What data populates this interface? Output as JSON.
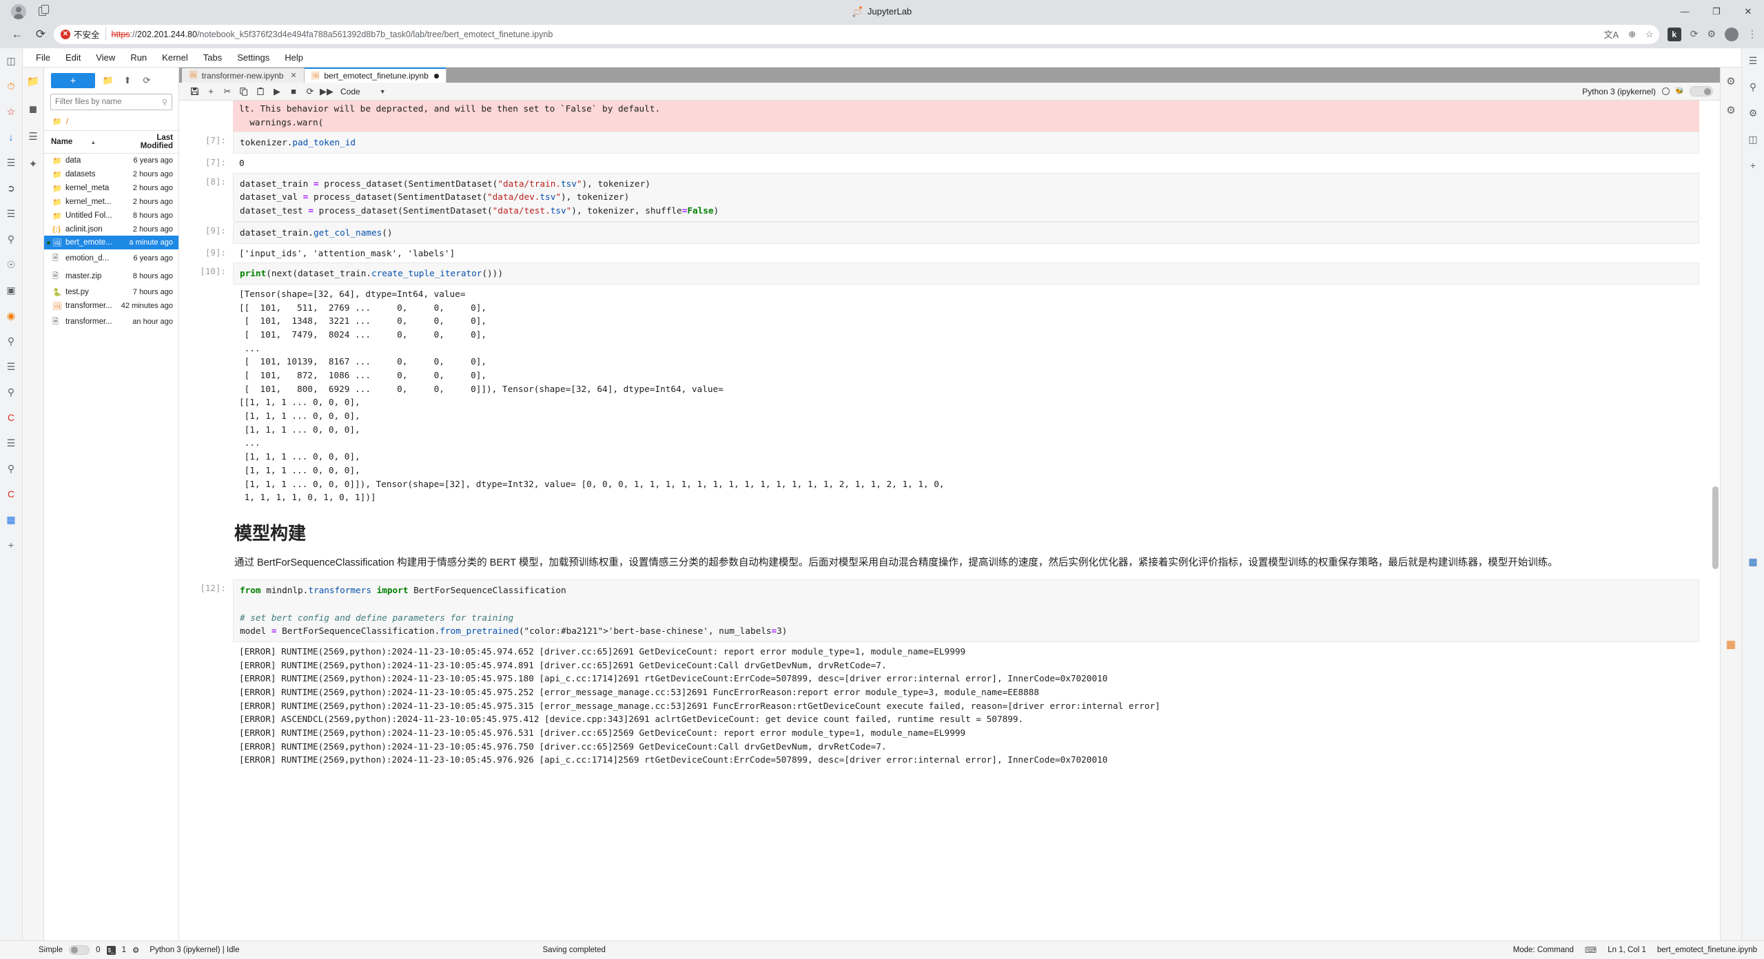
{
  "browser": {
    "title": "JupyterLab",
    "security_label": "不安全",
    "url_scheme": "https",
    "url_sep": "://",
    "url_host": "202.201.244.80",
    "url_path": "/notebook_k5f376f23d4e494fa788a561392d8b7b_task0/lab/tree/bert_emotect_finetune.ipynb",
    "window_minimize": "—",
    "window_maximize": "❐",
    "window_close": "✕",
    "back_icon": "←",
    "reload_icon": "⟳",
    "translate_icon": "文A",
    "zoom_icon": "⊕",
    "star_icon": "☆",
    "k_badge": "k",
    "refresh2_icon": "⟳",
    "ext_icon": "⚙",
    "menu_icon": "⋮"
  },
  "jupyter_menu": [
    "File",
    "Edit",
    "View",
    "Run",
    "Kernel",
    "Tabs",
    "Settings",
    "Help"
  ],
  "activity_bar": {
    "left_icons": [
      "folder-icon",
      "running-icon",
      "commands-icon",
      "extensions-icon"
    ],
    "right_icons": [
      "settings-icon",
      "property-inspector-icon",
      "debugger-icon"
    ]
  },
  "file_browser": {
    "new_button": "+",
    "new_folder_icon": "➕",
    "upload_icon": "↑",
    "refresh_icon": "⟳",
    "filter_placeholder": "Filter files by name",
    "search_icon": "⌕",
    "breadcrumb_root": "/",
    "columns": {
      "name": "Name",
      "modified": "Last Modified"
    },
    "items": [
      {
        "name": "data",
        "modified": "6 years ago",
        "kind": "folder",
        "selected": false,
        "running": false
      },
      {
        "name": "datasets",
        "modified": "2 hours ago",
        "kind": "folder",
        "selected": false,
        "running": false
      },
      {
        "name": "kernel_meta",
        "modified": "2 hours ago",
        "kind": "folder",
        "selected": false,
        "running": false
      },
      {
        "name": "kernel_met...",
        "modified": "2 hours ago",
        "kind": "folder",
        "selected": false,
        "running": false
      },
      {
        "name": "Untitled Fol...",
        "modified": "8 hours ago",
        "kind": "folder",
        "selected": false,
        "running": false
      },
      {
        "name": "aclinit.json",
        "modified": "2 hours ago",
        "kind": "json",
        "selected": false,
        "running": false
      },
      {
        "name": "bert_emote...",
        "modified": "a minute ago",
        "kind": "notebook",
        "selected": true,
        "running": true
      },
      {
        "name": "emotion_d...",
        "modified": "6 years ago",
        "kind": "file",
        "selected": false,
        "running": false
      },
      {
        "name": "master.zip",
        "modified": "8 hours ago",
        "kind": "file",
        "selected": false,
        "running": false
      },
      {
        "name": "test.py",
        "modified": "7 hours ago",
        "kind": "python",
        "selected": false,
        "running": false
      },
      {
        "name": "transformer...",
        "modified": "42 minutes ago",
        "kind": "notebook",
        "selected": false,
        "running": false
      },
      {
        "name": "transformer...",
        "modified": "an hour ago",
        "kind": "file",
        "selected": false,
        "running": false
      }
    ]
  },
  "notebook": {
    "tabs": [
      {
        "label": "transformer-new.ipynb",
        "active": false,
        "dirty": false,
        "closable": true
      },
      {
        "label": "bert_emotect_finetune.ipynb",
        "active": true,
        "dirty": true,
        "closable": false
      }
    ],
    "toolbar": {
      "save_icon": "ὋE",
      "insert_icon": "+",
      "cut_icon": "✂",
      "copy_icon": "❐",
      "paste_icon": "ὌB",
      "run_icon": "▶",
      "stop_icon": "■",
      "restart_icon": "⟳",
      "restart_run_all_icon": "▶▶",
      "cell_type": "Code",
      "cell_type_caret": "▾",
      "kernel_name": "Python 3 (ipykernel)",
      "kernel_busy_icon": "kernel-idle-circle",
      "debugger_icon": "bug-icon"
    },
    "cells": [
      {
        "type": "stderr",
        "prompt": "",
        "lines": [
          "lt. This behavior will be depracted, and will be then set to `False` by default.",
          "  warnings.warn("
        ]
      },
      {
        "type": "code",
        "prompt": "[7]:",
        "lines": [
          "tokenizer.pad_token_id"
        ]
      },
      {
        "type": "output",
        "prompt": "[7]:",
        "lines": [
          "0"
        ]
      },
      {
        "type": "code",
        "prompt": "[8]:",
        "lines": [
          "dataset_train = process_dataset(SentimentDataset(\"data/train.tsv\"), tokenizer)",
          "dataset_val = process_dataset(SentimentDataset(\"data/dev.tsv\"), tokenizer)",
          "dataset_test = process_dataset(SentimentDataset(\"data/test.tsv\"), tokenizer, shuffle=False)"
        ]
      },
      {
        "type": "code",
        "prompt": "[9]:",
        "lines": [
          "dataset_train.get_col_names()"
        ]
      },
      {
        "type": "output",
        "prompt": "[9]:",
        "lines": [
          "['input_ids', 'attention_mask', 'labels']"
        ]
      },
      {
        "type": "code",
        "prompt": "[10]:",
        "lines": [
          "print(next(dataset_train.create_tuple_iterator()))"
        ]
      },
      {
        "type": "output",
        "prompt": "",
        "lines": [
          "[Tensor(shape=[32, 64], dtype=Int64, value=",
          "[[  101,   511,  2769 ...     0,     0,     0],",
          " [  101,  1348,  3221 ...     0,     0,     0],",
          " [  101,  7479,  8024 ...     0,     0,     0],",
          " ...",
          " [  101, 10139,  8167 ...     0,     0,     0],",
          " [  101,   872,  1086 ...     0,     0,     0],",
          " [  101,   800,  6929 ...     0,     0,     0]]), Tensor(shape=[32, 64], dtype=Int64, value=",
          "[[1, 1, 1 ... 0, 0, 0],",
          " [1, 1, 1 ... 0, 0, 0],",
          " [1, 1, 1 ... 0, 0, 0],",
          " ...",
          " [1, 1, 1 ... 0, 0, 0],",
          " [1, 1, 1 ... 0, 0, 0],",
          " [1, 1, 1 ... 0, 0, 0]]), Tensor(shape=[32], dtype=Int32, value= [0, 0, 0, 1, 1, 1, 1, 1, 1, 1, 1, 1, 1, 1, 1, 1, 2, 1, 1, 2, 1, 1, 0,",
          " 1, 1, 1, 1, 0, 1, 0, 1])]"
        ]
      },
      {
        "type": "markdown_heading",
        "prompt": "",
        "text": "模型构建"
      },
      {
        "type": "markdown_paragraph",
        "prompt": "",
        "text": "通过 BertForSequenceClassification 构建用于情感分类的 BERT 模型，加载预训练权重，设置情感三分类的超参数自动构建模型。后面对模型采用自动混合精度操作，提高训练的速度，然后实例化优化器，紧接着实例化评价指标，设置模型训练的权重保存策略，最后就是构建训练器，模型开始训练。"
      },
      {
        "type": "code",
        "prompt": "[12]:",
        "lines": [
          "from mindnlp.transformers import BertForSequenceClassification",
          "",
          "# set bert config and define parameters for training",
          "model = BertForSequenceClassification.from_pretrained('bert-base-chinese', num_labels=3)"
        ]
      },
      {
        "type": "output",
        "prompt": "",
        "lines": [
          "[ERROR] RUNTIME(2569,python):2024-11-23-10:05:45.974.652 [driver.cc:65]2691 GetDeviceCount: report error module_type=1, module_name=EL9999",
          "[ERROR] RUNTIME(2569,python):2024-11-23-10:05:45.974.891 [driver.cc:65]2691 GetDeviceCount:Call drvGetDevNum, drvRetCode=7.",
          "[ERROR] RUNTIME(2569,python):2024-11-23-10:05:45.975.180 [api_c.cc:1714]2691 rtGetDeviceCount:ErrCode=507899, desc=[driver error:internal error], InnerCode=0x7020010",
          "[ERROR] RUNTIME(2569,python):2024-11-23-10:05:45.975.252 [error_message_manage.cc:53]2691 FuncErrorReason:report error module_type=3, module_name=EE8888",
          "[ERROR] RUNTIME(2569,python):2024-11-23-10:05:45.975.315 [error_message_manage.cc:53]2691 FuncErrorReason:rtGetDeviceCount execute failed, reason=[driver error:internal error]",
          "[ERROR] ASCENDCL(2569,python):2024-11-23-10:05:45.975.412 [device.cpp:343]2691 aclrtGetDeviceCount: get device count failed, runtime result = 507899.",
          "[ERROR] RUNTIME(2569,python):2024-11-23-10:05:45.976.531 [driver.cc:65]2569 GetDeviceCount: report error module_type=1, module_name=EL9999",
          "[ERROR] RUNTIME(2569,python):2024-11-23-10:05:45.976.750 [driver.cc:65]2569 GetDeviceCount:Call drvGetDevNum, drvRetCode=7.",
          "[ERROR] RUNTIME(2569,python):2024-11-23-10:05:45.976.926 [api_c.cc:1714]2569 rtGetDeviceCount:ErrCode=507899, desc=[driver error:internal error], InnerCode=0x7020010"
        ]
      }
    ]
  },
  "status_bar": {
    "simple_label": "Simple",
    "terminal_count": "0",
    "terminal_icon": "$_",
    "kernel_count": "1",
    "kernel_icon": "⚙",
    "kernel_status": "Python 3 (ipykernel) | Idle",
    "save_status": "Saving completed",
    "mode": "Mode: Command",
    "position": "Ln 1, Col 1",
    "filename": "bert_emotect_finetune.ipynb"
  },
  "colors": {
    "accent": "#1e88e5",
    "jupyter_orange": "#e87b1e",
    "stderr_bg": "#fdd8d8",
    "selected_row": "#1e88e5"
  }
}
